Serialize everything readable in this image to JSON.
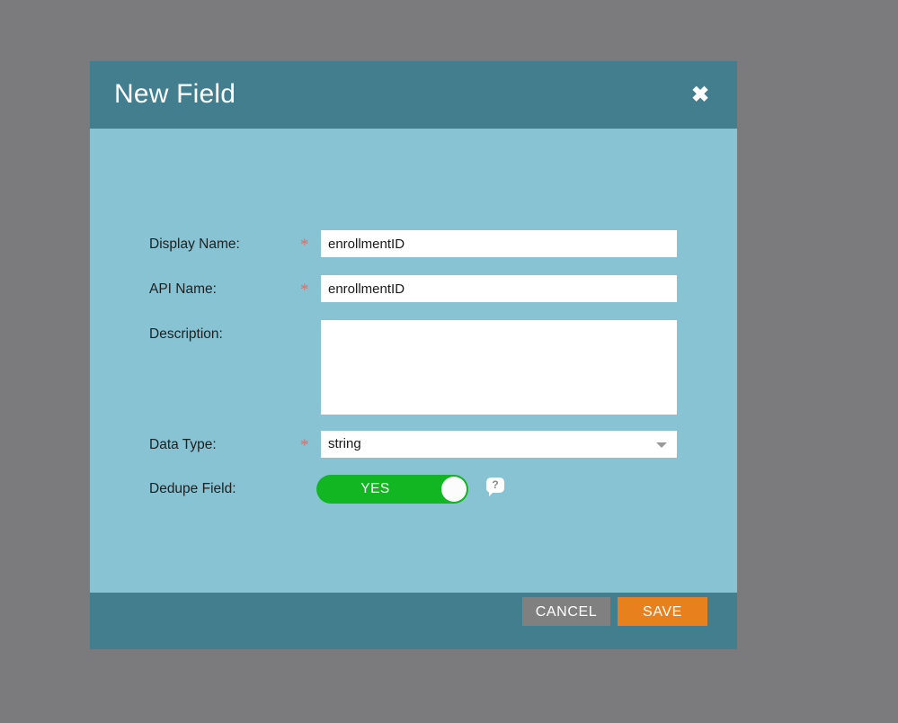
{
  "dialog": {
    "title": "New Field",
    "close_icon": "close-icon",
    "colors": {
      "header": "#437e8e",
      "body": "#87c3d3",
      "footer": "#437e8e",
      "page_background": "#7b7b7d",
      "required_star": "#d9726d",
      "toggle_on": "#12b522",
      "save_button": "#e8801e",
      "cancel_button": "#808080"
    }
  },
  "form": {
    "display_name": {
      "label": "Display Name:",
      "required_marker": "*",
      "value": "enrollmentID",
      "placeholder": ""
    },
    "api_name": {
      "label": "API Name:",
      "required_marker": "*",
      "value": "enrollmentID",
      "placeholder": ""
    },
    "description": {
      "label": "Description:",
      "value": "",
      "placeholder": ""
    },
    "data_type": {
      "label": "Data Type:",
      "required_marker": "*",
      "value": "string",
      "arrow_icon": "chevron-down-icon"
    },
    "dedupe_field": {
      "label": "Dedupe Field:",
      "toggle_value": "YES",
      "help_icon": "help-icon",
      "help_glyph": "?"
    }
  },
  "footer": {
    "cancel_label": "CANCEL",
    "save_label": "SAVE"
  }
}
